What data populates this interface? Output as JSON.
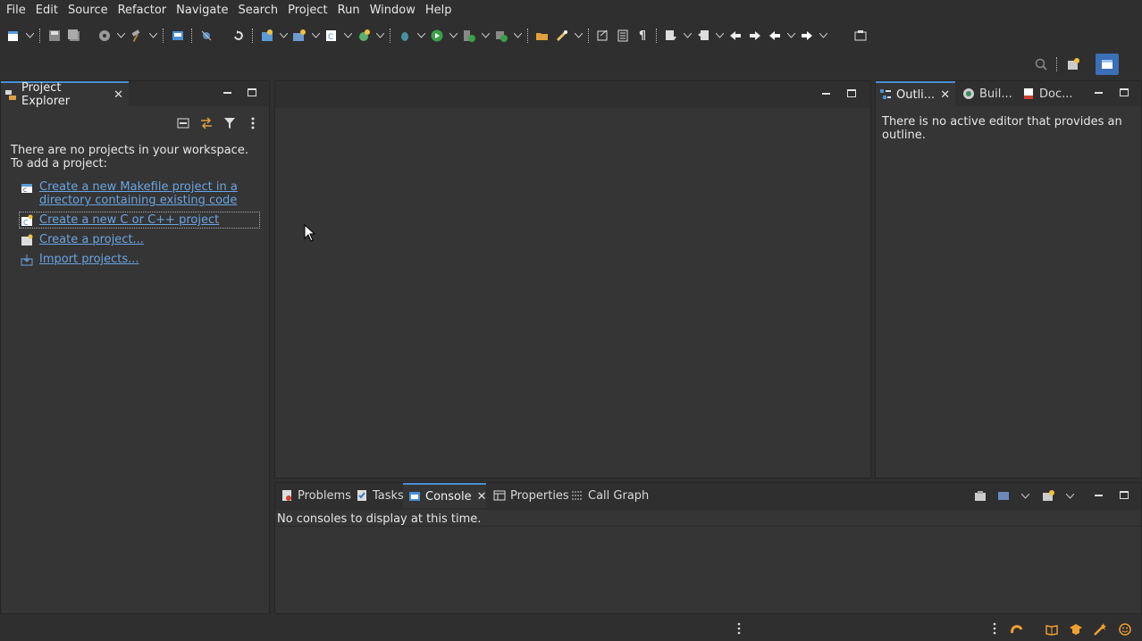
{
  "menubar": {
    "items": [
      "File",
      "Edit",
      "Source",
      "Refactor",
      "Navigate",
      "Search",
      "Project",
      "Run",
      "Window",
      "Help"
    ]
  },
  "toolbar": {
    "icons": [
      "new-icon",
      "save-icon",
      "save-all-icon",
      "build-icon",
      "hammer-icon",
      "terminal-icon",
      "debug-icon",
      "refresh-icon",
      "new-c-project-icon",
      "new-folder-icon",
      "new-class-icon",
      "new-file-icon",
      "bug-icon",
      "run-icon",
      "coverage-icon",
      "external-tool-icon",
      "open-type-icon",
      "search-wand-icon",
      "toggle-mark-icon",
      "block-select-icon",
      "show-whitespace-icon",
      "annotation-icon",
      "prev-annotation-icon",
      "last-edit-icon",
      "forward-edit-icon",
      "back-icon",
      "forward-icon",
      "pin-icon"
    ]
  },
  "project_explorer": {
    "tab_label": "Project Explorer",
    "message_line1": "There are no projects in your workspace.",
    "message_line2": "To add a project:",
    "links": [
      {
        "line1": "Create a new Makefile project in a",
        "line2": "directory containing existing code"
      },
      {
        "line1": "Create a new C or C++ project",
        "line2": ""
      },
      {
        "line1": "Create a project...",
        "line2": ""
      },
      {
        "line1": "Import projects...",
        "line2": ""
      }
    ]
  },
  "outline": {
    "tabs": [
      "Outli...",
      "Buil...",
      "Doc..."
    ],
    "message_line1": "There is no active editor that provides an",
    "message_line2": "outline."
  },
  "bottom": {
    "tabs": [
      "Problems",
      "Tasks",
      "Console",
      "Properties",
      "Call Graph"
    ],
    "console_message": "No consoles to display at this time."
  },
  "colors": {
    "background": "#2f2f2f",
    "panel": "#353535",
    "link": "#6aa4e0",
    "accent": "#4a8fd4",
    "warning_orange": "#f0a030"
  }
}
